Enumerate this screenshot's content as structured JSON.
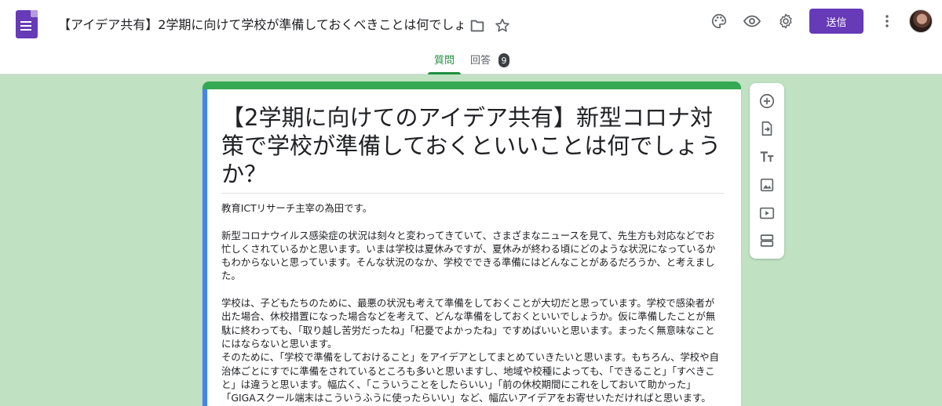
{
  "header": {
    "doc_title": "【アイデア共有】2学期に向けて学校が準備しておくべきことは何でしょ",
    "send_label": "送信",
    "icons": [
      "forms-logo-icon",
      "folder-icon",
      "star-icon",
      "palette-icon",
      "eye-icon",
      "gear-icon",
      "more-vert-icon"
    ]
  },
  "tabs": {
    "questions": "質問",
    "responses": "回答",
    "responses_count": "9",
    "active": "questions"
  },
  "form": {
    "title": "【2学期に向けてのアイデア共有】新型コロナ対策で学校が準備しておくといいことは何でしょうか？",
    "description": [
      "教育ICTリサーチ主宰の為田です。",
      "",
      "新型コロナウイルス感染症の状況は刻々と変わってきていて、さまざまなニュースを見て、先生方も対応などでお忙しくされているかと思います。いまは学校は夏休みですが、夏休みが終わる頃にどのような状況になっているかもわからないと思っています。そんな状況のなか、学校でできる準備にはどんなことがあるだろうか、と考えました。",
      "",
      "学校は、子どもたちのために、最悪の状況も考えて準備をしておくことが大切だと思っています。学校で感染者が出た場合、休校措置になった場合などを考えて、どんな準備をしておくといいでしょうか。仮に準備したことが無駄に終わっても、「取り越し苦労だったね」「杞憂でよかったね」ですめばいいと思います。まったく無意味なことにはならないと思います。",
      "そのために、「学校で準備をしておけること」をアイデアとしてまとめていきたいと思います。もちろん、学校や自治体ごとにすでに準備をされているところも多いと思いますし、地域や校種によっても、「できること」「すべきこと」は違うと思います。幅広く、「こういうことをしたらいい」「前の休校期間にこれをしておいて助かった」「GIGAスクール端末はこういうふうに使ったらいい」など、幅広いアイデアをお寄せいただければと思います。"
    ]
  },
  "toolbar": {
    "items": [
      "add-question-icon",
      "import-questions-icon",
      "add-title-icon",
      "add-image-icon",
      "add-video-icon",
      "add-section-icon"
    ]
  },
  "colors": {
    "accent": "#673ab7",
    "background": "#c0e2c3",
    "card_top": "#34a853",
    "card_left": "#4285f4",
    "active_tab": "#1e8e3e"
  }
}
